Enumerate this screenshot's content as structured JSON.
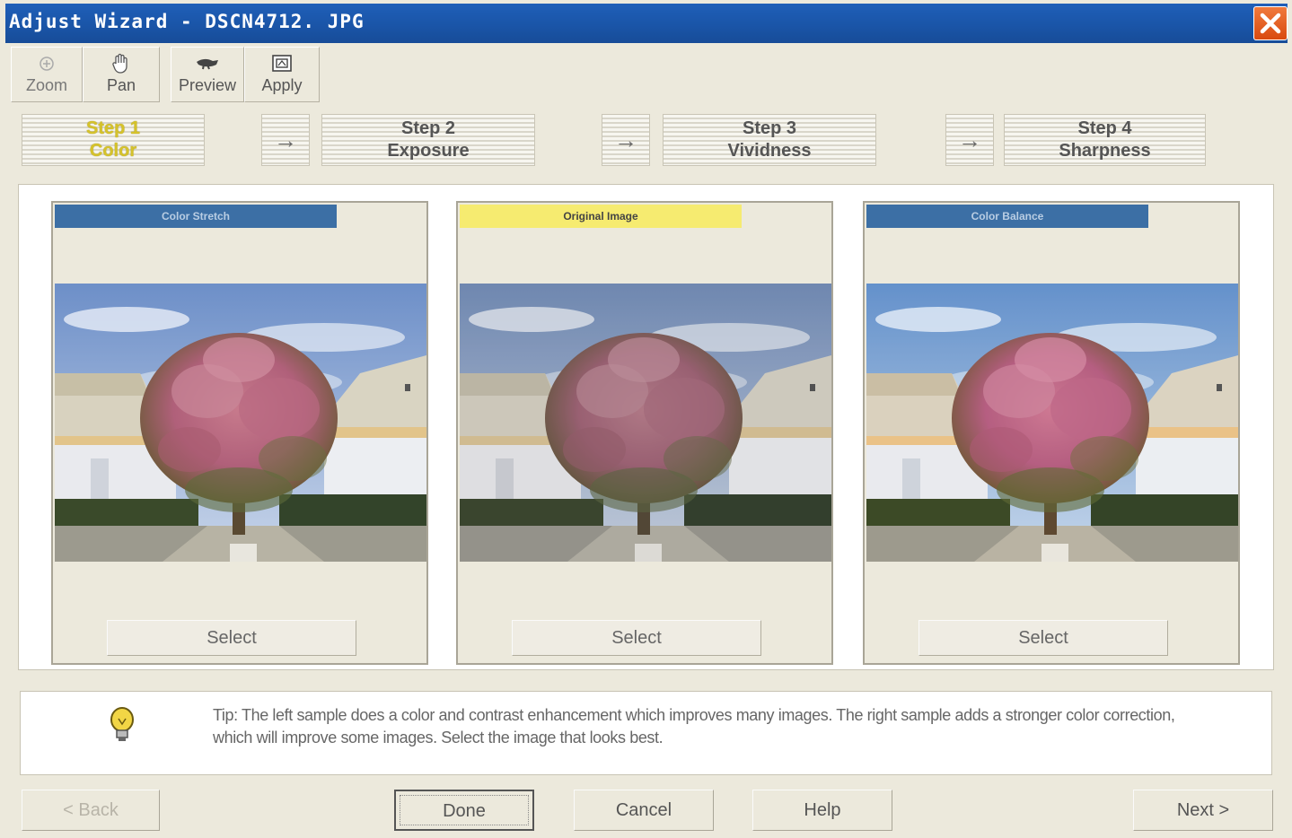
{
  "window": {
    "title": "Adjust Wizard - DSCN4712. JPG",
    "close_icon": "close-icon"
  },
  "toolbar": {
    "zoom": {
      "label": "Zoom",
      "icon": "zoom-icon",
      "enabled": false
    },
    "pan": {
      "label": "Pan",
      "icon": "hand-icon"
    },
    "preview": {
      "label": "Preview",
      "icon": "preview-icon"
    },
    "apply": {
      "label": "Apply",
      "icon": "apply-icon"
    }
  },
  "steps": [
    {
      "title": "Step 1",
      "subtitle": "Color",
      "active": true
    },
    {
      "title": "Step 2",
      "subtitle": "Exposure",
      "active": false
    },
    {
      "title": "Step 3",
      "subtitle": "Vividness",
      "active": false
    },
    {
      "title": "Step 4",
      "subtitle": "Sharpness",
      "active": false
    }
  ],
  "step_arrow": "→",
  "samples": [
    {
      "label": "Color Stretch",
      "button": "Select"
    },
    {
      "label": "Original Image",
      "button": "Select"
    },
    {
      "label": "Color Balance",
      "button": "Select"
    }
  ],
  "tip": {
    "icon": "lightbulb-icon",
    "text": "Tip: The left sample does a color and contrast enhancement which improves many images. The right sample adds a stronger color correction, which will improve some images. Select the image that looks best."
  },
  "buttons": {
    "back": "< Back",
    "done": "Done",
    "cancel": "Cancel",
    "help": "Help",
    "next": "Next >"
  },
  "colors": {
    "titlebar": "#1a55a8",
    "active_step": "#d5c22a",
    "sample_label_blue": "#3c6fa5",
    "sample_label_original": "#f6eb70"
  }
}
